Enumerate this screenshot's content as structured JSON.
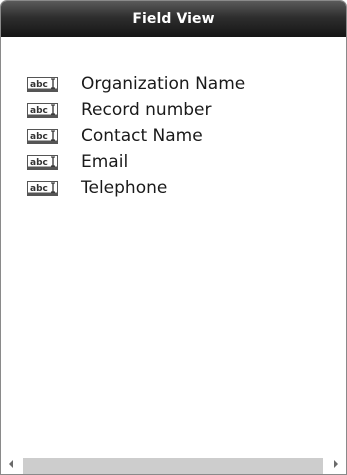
{
  "panel": {
    "title": "Field View"
  },
  "fields": [
    {
      "label": "Organization Name",
      "icon": "text-field-icon"
    },
    {
      "label": "Record number",
      "icon": "text-field-icon"
    },
    {
      "label": "Contact Name",
      "icon": "text-field-icon"
    },
    {
      "label": "Email",
      "icon": "text-field-icon"
    },
    {
      "label": "Telephone",
      "icon": "text-field-icon"
    }
  ],
  "icon_text": "abc",
  "colors": {
    "title_bar": "#1f1f1f",
    "scroll_thumb": "#cdcdcd"
  }
}
